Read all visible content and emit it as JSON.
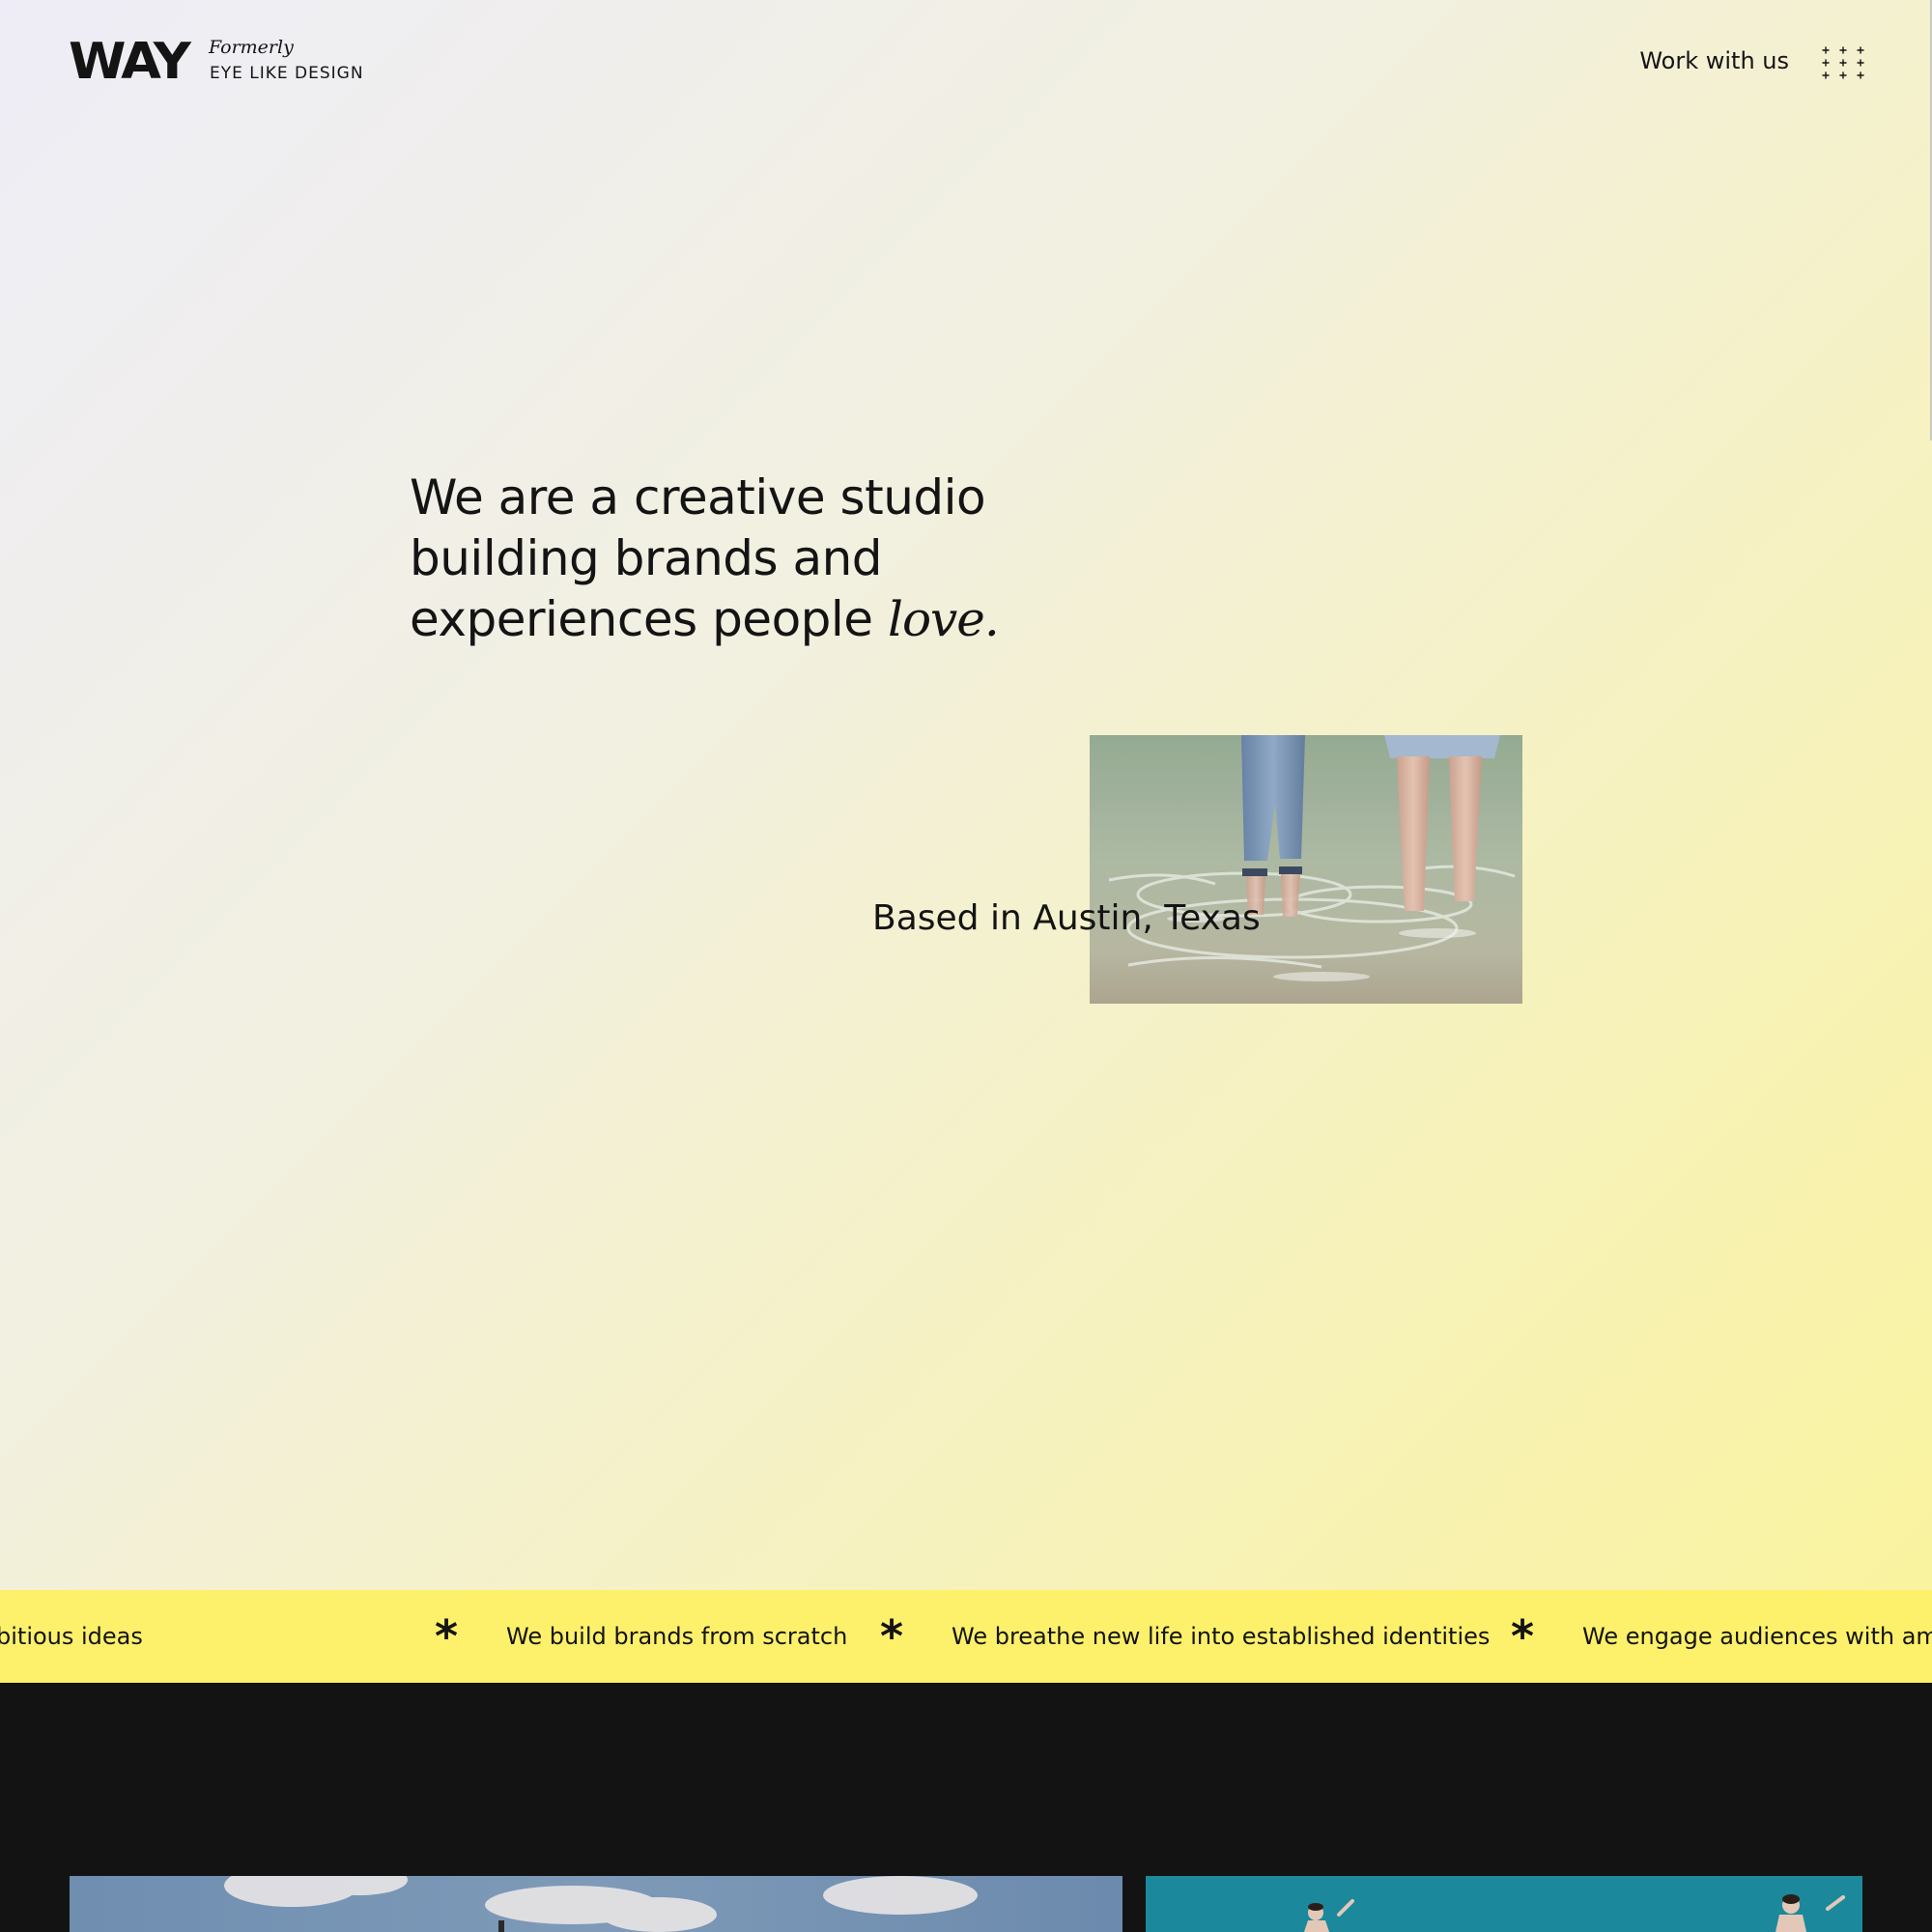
{
  "brand": {
    "wordmark": "WAY",
    "formerly_label": "Formerly",
    "former_name": "EYE LIKE DESIGN"
  },
  "nav": {
    "cta_label": "Work with us",
    "menu_icon": "grid-plus-icon"
  },
  "hero": {
    "headline_main": "We are a creative studio building brands and experiences people ",
    "headline_accent": "love.",
    "location": "Based in Austin, Texas",
    "photo": "two-people-wading-in-water"
  },
  "ticker": {
    "separator": "*",
    "items": [
      "We engage audiences with ambitious ideas",
      "We build brands from scratch",
      "We breathe new life into established identities",
      "We engage audiences with ambitious ideas"
    ],
    "visible_fragments": [
      "bitious ideas",
      "We build brands from scratch",
      "We breathe new life into established identities",
      "We engage audiences with amb"
    ]
  },
  "work": {
    "cards": [
      {
        "subject": "sky-with-clouds"
      },
      {
        "subject": "people-jumping-teal-sky"
      }
    ]
  },
  "colors": {
    "ink": "#141414",
    "ticker_bg": "#fdf06b",
    "dark_bg": "#131313",
    "gradient_start": "#eeedf7",
    "gradient_end": "#f9f39f"
  }
}
